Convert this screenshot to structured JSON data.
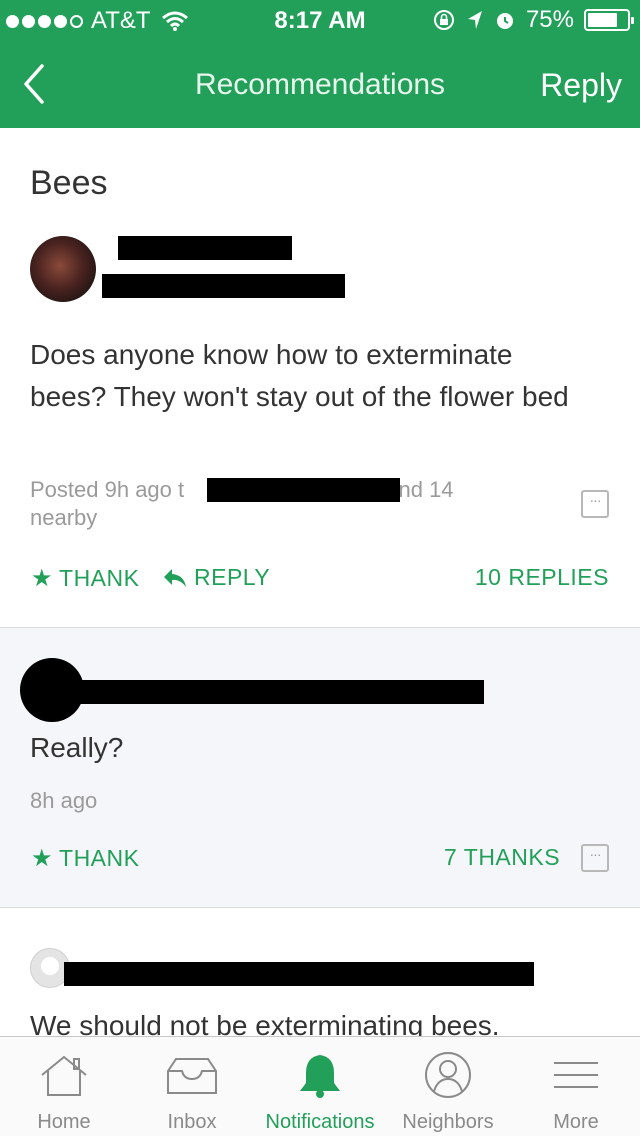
{
  "status_bar": {
    "carrier": "AT&T",
    "time": "8:17 AM",
    "battery_percent_label": "75%",
    "battery_level": 0.75
  },
  "nav": {
    "title": "Recommendations",
    "reply_label": "Reply"
  },
  "post": {
    "topic": "Bees",
    "body": "Does anyone know how to exterminate bees? They won't stay out of the flower bed",
    "meta_prefix": "Posted 9h ago t",
    "meta_suffix": "and 14",
    "meta_line2": "nearby",
    "thank_label": "THANK",
    "reply_label": "REPLY",
    "replies_label": "10 REPLIES"
  },
  "replies": [
    {
      "text": "Really?",
      "time": "8h ago",
      "thank_label": "THANK",
      "thanks_count_label": "7 THANKS"
    },
    {
      "text": "We should not be exterminating bees."
    }
  ],
  "tabs": [
    {
      "label": "Home",
      "icon": "home-icon",
      "active": false
    },
    {
      "label": "Inbox",
      "icon": "inbox-icon",
      "active": false
    },
    {
      "label": "Notifications",
      "icon": "bell-icon",
      "active": true
    },
    {
      "label": "Neighbors",
      "icon": "neighbors-icon",
      "active": false
    },
    {
      "label": "More",
      "icon": "menu-icon",
      "active": false
    }
  ],
  "colors": {
    "brand_green": "#22a05a",
    "reply_background": "#f5f6fa"
  }
}
